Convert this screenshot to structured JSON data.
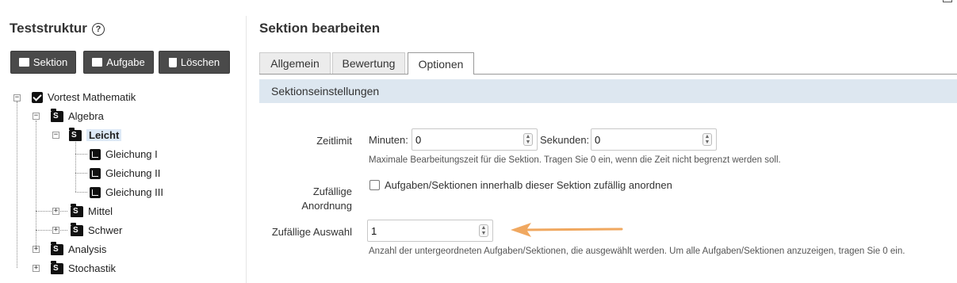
{
  "left": {
    "title": "Teststruktur",
    "buttons": {
      "section": "Sektion",
      "task": "Aufgabe",
      "delete": "Löschen"
    },
    "tree": {
      "root": "Vortest Mathematik",
      "algebra": "Algebra",
      "leicht": "Leicht",
      "g1": "Gleichung I",
      "g2": "Gleichung II",
      "g3": "Gleichung III",
      "mittel": "Mittel",
      "schwer": "Schwer",
      "analysis": "Analysis",
      "stochastik": "Stochastik"
    }
  },
  "main": {
    "title": "Sektion bearbeiten",
    "tabs": [
      "Allgemein",
      "Bewertung",
      "Optionen"
    ],
    "active_tab": "Optionen",
    "section_header": "Sektionseinstellungen",
    "timelimit": {
      "label": "Zeitlimit",
      "minutes_label": "Minuten:",
      "minutes_value": "0",
      "seconds_label": "Sekunden:",
      "seconds_value": "0",
      "help": "Maximale Bearbeitungszeit für die Sektion. Tragen Sie 0 ein, wenn die Zeit nicht begrenzt werden soll."
    },
    "random_order": {
      "label_line1": "Zufällige",
      "label_line2": "Anordnung",
      "checkbox_label": "Aufgaben/Sektionen innerhalb dieser Sektion zufällig anordnen",
      "checked": false
    },
    "random_selection": {
      "label": "Zufällige Auswahl",
      "value": "1",
      "help": "Anzahl der untergeordneten Aufgaben/Sektionen, die ausgewählt werden. Um alle Aufgaben/Sektionen anzuzeigen, tragen Sie 0 ein."
    }
  },
  "colors": {
    "arrow": "#f0a860",
    "section_bar": "#dde7f0",
    "button_dark": "#4a4a4a"
  },
  "icons": [
    "help-icon",
    "section-icon",
    "task-icon",
    "trash-icon",
    "checkbox-icon",
    "folder-icon",
    "arrow-annotation"
  ]
}
